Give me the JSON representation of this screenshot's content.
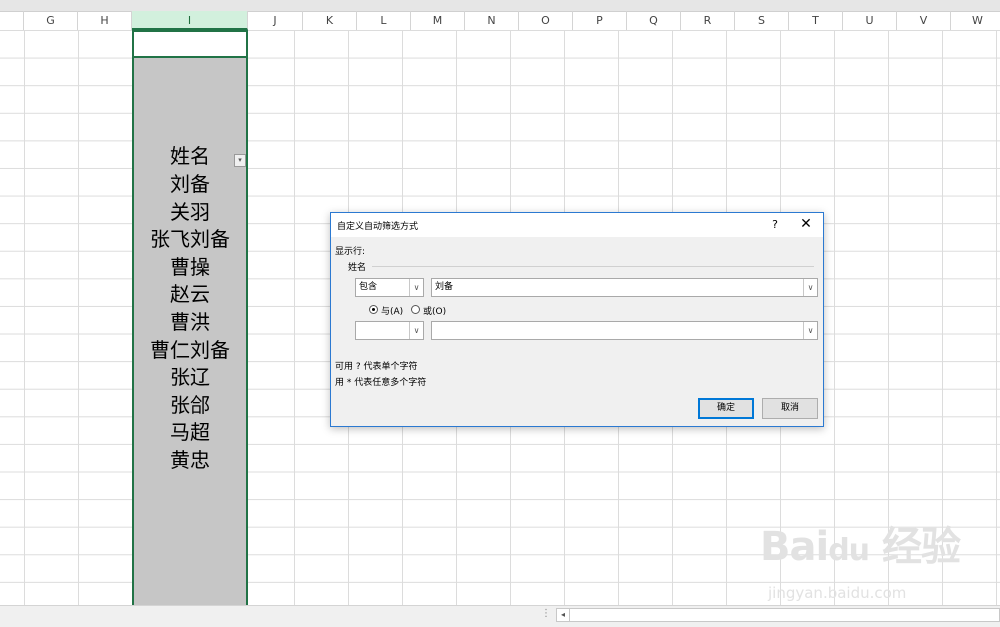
{
  "columns": [
    "G",
    "H",
    "I",
    "J",
    "K",
    "L",
    "M",
    "N",
    "O",
    "P",
    "Q",
    "R",
    "S",
    "T",
    "U",
    "V",
    "W"
  ],
  "cells": {
    "I5": "姓名",
    "names": [
      "刘备",
      "关羽",
      "张飞刘备",
      "曹操",
      "赵云",
      "曹洪",
      "曹仁刘备",
      "张辽",
      "张郃",
      "马超",
      "黄忠"
    ]
  },
  "filter_icon": "dropdown-arrow-icon",
  "dialog": {
    "title": "自定义自动筛选方式",
    "help": "?",
    "close": "✕",
    "show_rows_label": "显示行:",
    "field_label": "姓名",
    "condition1": {
      "operator": "包含",
      "value": "刘备"
    },
    "logic": {
      "and_label": "与(A)",
      "or_label": "或(O)",
      "selected": "and"
    },
    "condition2": {
      "operator": "",
      "value": ""
    },
    "hint1": "可用 ? 代表单个字符",
    "hint2": "用 * 代表任意多个字符",
    "ok_label": "确定",
    "cancel_label": "取消"
  },
  "watermark": {
    "text": "Bai du 经验",
    "url": "jingyan.baidu.com"
  },
  "colors": {
    "accent": "#217346",
    "dialog_border": "#2b79d1",
    "selection": "#c6c6c6"
  }
}
